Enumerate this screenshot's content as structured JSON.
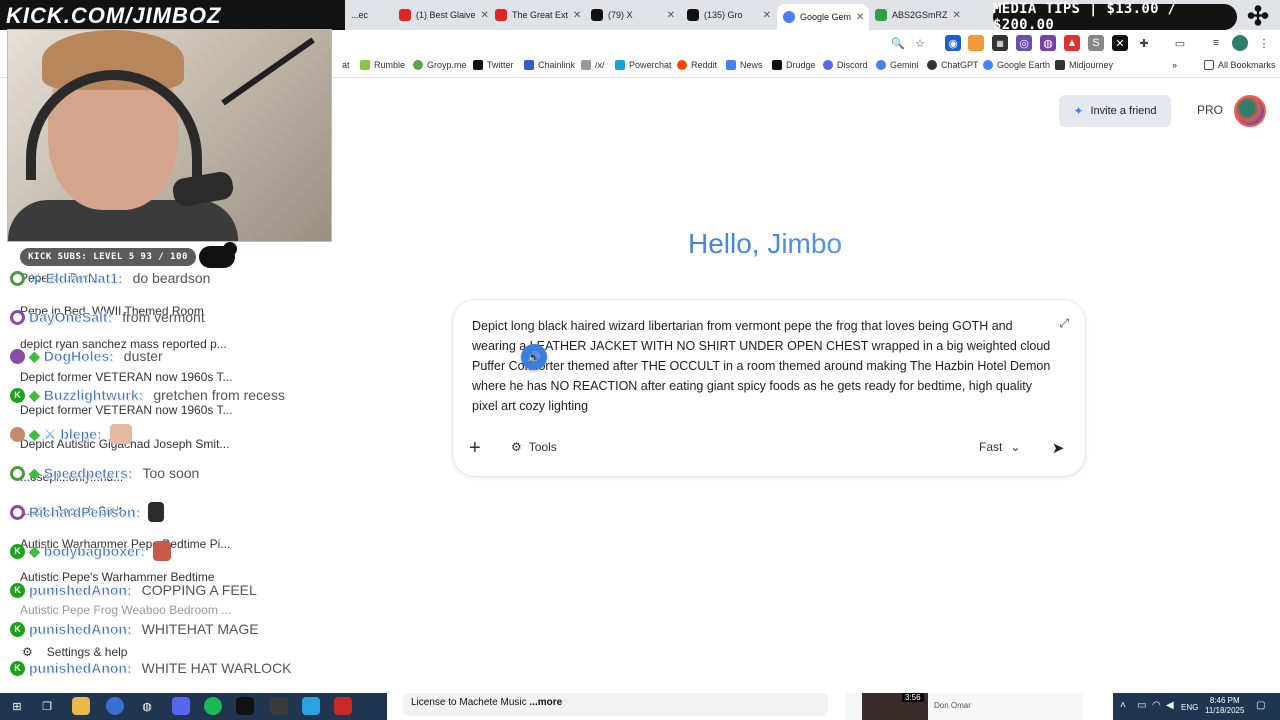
{
  "browser": {
    "tabs": [
      {
        "title": "...ec",
        "fav_color": "#6c6c6c",
        "active": false
      },
      {
        "title": "(1) Best Glaive",
        "fav_color": "#e02424",
        "active": false
      },
      {
        "title": "The Great Ext",
        "fav_color": "#e02424",
        "active": false
      },
      {
        "title": "(79) X",
        "fav_color": "#111111",
        "active": false
      },
      {
        "title": "(135) Gro",
        "fav_color": "#111111",
        "active": false
      },
      {
        "title": "Google Gem",
        "fav_color": "#4a7ff1",
        "active": true
      },
      {
        "title": "ABS2GSmRZ",
        "fav_color": "#2f9e44",
        "active": false
      }
    ],
    "bookmarks": [
      {
        "label": "at",
        "icon": "bookmark-icon",
        "color": "#888888"
      },
      {
        "label": "Rumble",
        "icon": "rumble-icon",
        "color": "#85c742"
      },
      {
        "label": "Groyp.me",
        "icon": "frog-icon",
        "color": "#5aa647"
      },
      {
        "label": "Twitter",
        "icon": "x-icon",
        "color": "#111111"
      },
      {
        "label": "Chainlink",
        "icon": "chainlink-icon",
        "color": "#375bd2"
      },
      {
        "label": "/x/",
        "icon": "folder-icon",
        "color": "#777777"
      },
      {
        "label": "Powerchat",
        "icon": "powerchat-icon",
        "color": "#16a3d4"
      },
      {
        "label": "Reddit",
        "icon": "reddit-icon",
        "color": "#ff4500"
      },
      {
        "label": "News",
        "icon": "news-icon",
        "color": "#4a7ff1"
      },
      {
        "label": "Drudge",
        "icon": "drudge-icon",
        "color": "#111111"
      },
      {
        "label": "Discord",
        "icon": "discord-icon",
        "color": "#5865f2"
      },
      {
        "label": "Gemini",
        "icon": "gemini-icon",
        "color": "#4a7ff1"
      },
      {
        "label": "ChatGPT",
        "icon": "chatgpt-icon",
        "color": "#333333"
      },
      {
        "label": "Google Earth",
        "icon": "earth-icon",
        "color": "#4285f4"
      },
      {
        "label": "Midjourney",
        "icon": "midjourney-icon",
        "color": "#333333"
      }
    ],
    "all_bookmarks_label": "All Bookmarks"
  },
  "gemini": {
    "invite_label": "Invite a friend",
    "pro_label": "PRO",
    "greeting": "Hello, Jimbo",
    "prompt_text": "Depict long black haired wizard libertarian from vermont pepe the frog that loves being GOTH and wearing a LEATHER JACKET WITH NO SHIRT UNDER OPEN CHEST wrapped in a big weighted cloud Puffer Comforter themed after THE OCCULT in a room themed around making The Hazbin Hotel Demon where he has NO REACTION after eating giant spicy foods as he gets ready for bedtime, high quality pixel art cozy lighting",
    "tools_label": "Tools",
    "mode_label": "Fast"
  },
  "overlay": {
    "channel_url": "KICK.COM/JIMBOZ",
    "subs_bar": "KICK SUBS: LEVEL 5 93 / 100",
    "media_tips": "MEDIA TIPS | $13.00 / $200.00",
    "chat": [
      {
        "user": "EldianNat1:",
        "msg": "do beardson",
        "badge": "ring",
        "gem": false,
        "sword": true
      },
      {
        "user": "DayOneSalt:",
        "msg": "from vermont",
        "badge": "ring-purple",
        "gem": false,
        "sword": false
      },
      {
        "user": "DogHoles:",
        "msg": "duster",
        "badge": "cup",
        "gem": true,
        "sword": false
      },
      {
        "user": "Buzzlightwurk:",
        "msg": "gretchen from recess",
        "badge": "k",
        "gem": true,
        "sword": false
      },
      {
        "user": "blepe:",
        "msg": "",
        "badge": "emote",
        "gem": true,
        "sword": true
      },
      {
        "user": "Speedpeters:",
        "msg": "Too soon",
        "badge": "ring",
        "gem": true,
        "sword": false
      },
      {
        "user": "RichardPenison:",
        "msg": "",
        "badge": "ring-purple",
        "gem": false,
        "sword": false
      },
      {
        "user": "bodybagboxer:",
        "msg": "",
        "badge": "k",
        "gem": true,
        "sword": false
      },
      {
        "user": "punishedAnon:",
        "msg": "COPPING A FEEL",
        "badge": "k",
        "gem": false,
        "sword": false
      },
      {
        "user": "punishedAnon:",
        "msg": "WHITEHAT MAGE",
        "badge": "k",
        "gem": false,
        "sword": false
      },
      {
        "user": "punishedAnon:",
        "msg": "WHITE HAT WARLOCK",
        "badge": "k",
        "gem": false,
        "sword": false
      }
    ],
    "history": [
      "Pepe's ...Bed...",
      "Pepe in Bed, WWII Themed Room",
      "depict ryan sanchez mass reported p...",
      "Depict former VETERAN now 1960s T...",
      "Depict former VETERAN now 1960s T...",
      "Depict Autistic Gigachad Joseph Smit...",
      "...osepl...only...nd...",
      "...ect...Joseph Smit...",
      "Autistic Warhammer Pepe Bedtime Pi...",
      "Autistic Pepe's Warhammer Bedtime",
      "Autistic Pepe Frog Weaboo Bedroom ..."
    ],
    "settings_label": "Settings & help"
  },
  "bottom": {
    "yt_desc": "License to Machete Music",
    "yt_more": "...more",
    "yt_duration": "3:56",
    "yt_channel": "Don Omar",
    "lang": "ENG",
    "time": "8:46 PM",
    "date": "11/18/2025"
  }
}
